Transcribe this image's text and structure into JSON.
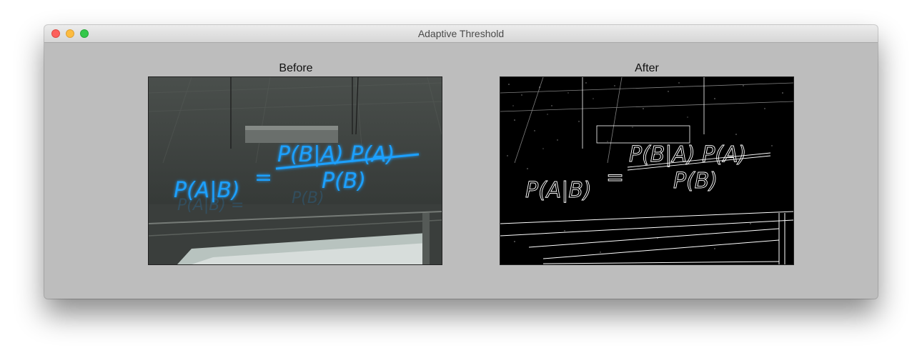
{
  "window": {
    "title": "Adaptive Threshold",
    "controls": {
      "close_color": "#fc605c",
      "minimize_color": "#fdbc40",
      "zoom_color": "#34c84a"
    }
  },
  "panels": [
    {
      "title": "Before",
      "image": "neon-bayes-formula-photo"
    },
    {
      "title": "After",
      "image": "adaptive-threshold-binary-result"
    }
  ],
  "formula": {
    "lhs": "P(A|B)",
    "equals": "=",
    "numerator": "P(B|A) P(A)",
    "denominator": "P(B)"
  },
  "colors": {
    "neon": "#1ea0ff",
    "content_background": "#bdbdbd"
  }
}
